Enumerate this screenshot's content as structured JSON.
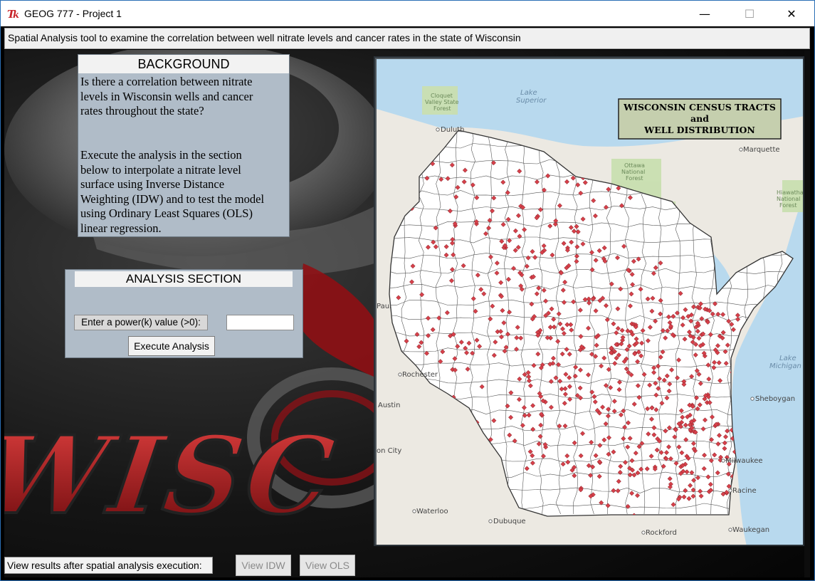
{
  "window": {
    "title": "GEOG 777 - Project 1",
    "controls": {
      "minimize": "—",
      "maximize": "☐",
      "close": "✕"
    }
  },
  "subtitle": "Spatial Analysis tool to examine the correlation between well nitrate levels and cancer rates in the state of Wisconsin",
  "background_panel": {
    "header": "BACKGROUND",
    "lines": [
      "Is there a correlation between nitrate",
      "levels in Wisconsin wells and cancer",
      "rates throughout the state?",
      "",
      "",
      "Execute the analysis in the section",
      "below to interpolate a nitrate level",
      "surface using Inverse Distance",
      "Weighting (IDW) and to test the model",
      "using Ordinary Least Squares (OLS)",
      "linear regression."
    ]
  },
  "analysis_panel": {
    "header": "ANALYSIS SECTION",
    "power_label": "Enter a power(k) value (>0):",
    "power_value": "",
    "execute_label": "Execute Analysis"
  },
  "map": {
    "legend_lines": [
      "WISCONSIN CENSUS TRACTS",
      "and",
      "WELL DISTRIBUTION"
    ],
    "place_labels": {
      "duluth": "Duluth",
      "marquette": "Marquette",
      "lake_superior_1": "Lake",
      "lake_superior_2": "Superior",
      "cloquet_1": "Cloquet",
      "cloquet_2": "Valley State",
      "cloquet_3": "Forest",
      "ottawa_1": "Ottawa",
      "ottawa_2": "National",
      "ottawa_3": "Forest",
      "hiawatha_1": "Hiawatha",
      "hiawatha_2": "National",
      "hiawatha_3": "Forest",
      "lake_michigan_1": "Lake",
      "lake_michigan_2": "Michigan",
      "rochester": "Rochester",
      "austin": "Austin",
      "sheboygan": "Sheboygan",
      "milwaukee": "Milwaukee",
      "racine": "Racine",
      "waterloo": "Waterloo",
      "dubuque": "Dubuque",
      "rockford": "Rockford",
      "waukegan": "Waukegan",
      "paul": "Paul",
      "mason_city": "on City"
    }
  },
  "bottom": {
    "label": "View results after spatial analysis execution:",
    "view_idw": "View IDW",
    "view_ols": "View OLS"
  },
  "background_art_text": "WISC",
  "colors": {
    "panel": "#b0bcc8",
    "water": "#b8d9ee",
    "land": "#ece9e2",
    "forest": "#c9dfb0",
    "well_dot": "#d6404a",
    "legend_bg": "#c5cfae",
    "logo_red": "#b3161c"
  }
}
